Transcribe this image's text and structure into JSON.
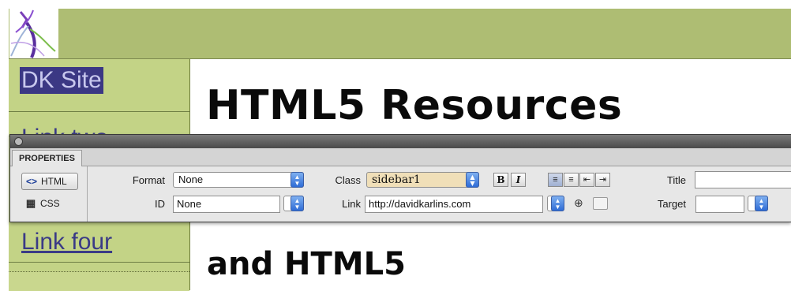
{
  "page": {
    "sidebar_links": [
      "DK Site",
      "Link two",
      "Link four"
    ],
    "heading": "HTML5 Resources",
    "subheading": "and HTML5"
  },
  "inspector": {
    "tab_label": "PROPERTIES",
    "modes": {
      "html": "HTML",
      "css": "CSS",
      "selected": "HTML"
    },
    "format_label": "Format",
    "format_value": "None",
    "id_label": "ID",
    "id_value": "None",
    "class_label": "Class",
    "class_value": "sidebar1",
    "link_label": "Link",
    "link_value": "http://davidkarlins.com",
    "bold_label": "B",
    "italic_label": "I",
    "title_label": "Title",
    "title_value": "",
    "target_label": "Target",
    "target_value": "",
    "icons": [
      "html-code-icon",
      "css-grid-icon",
      "unordered-list-icon",
      "ordered-list-icon",
      "outdent-icon",
      "indent-icon",
      "point-to-file-icon",
      "browse-folder-icon"
    ]
  },
  "colors": {
    "banner": "#aebd73",
    "sidebar": "#c3d386",
    "active_link_bg": "#3b3884",
    "class_field_bg": "#f0dfb8"
  }
}
